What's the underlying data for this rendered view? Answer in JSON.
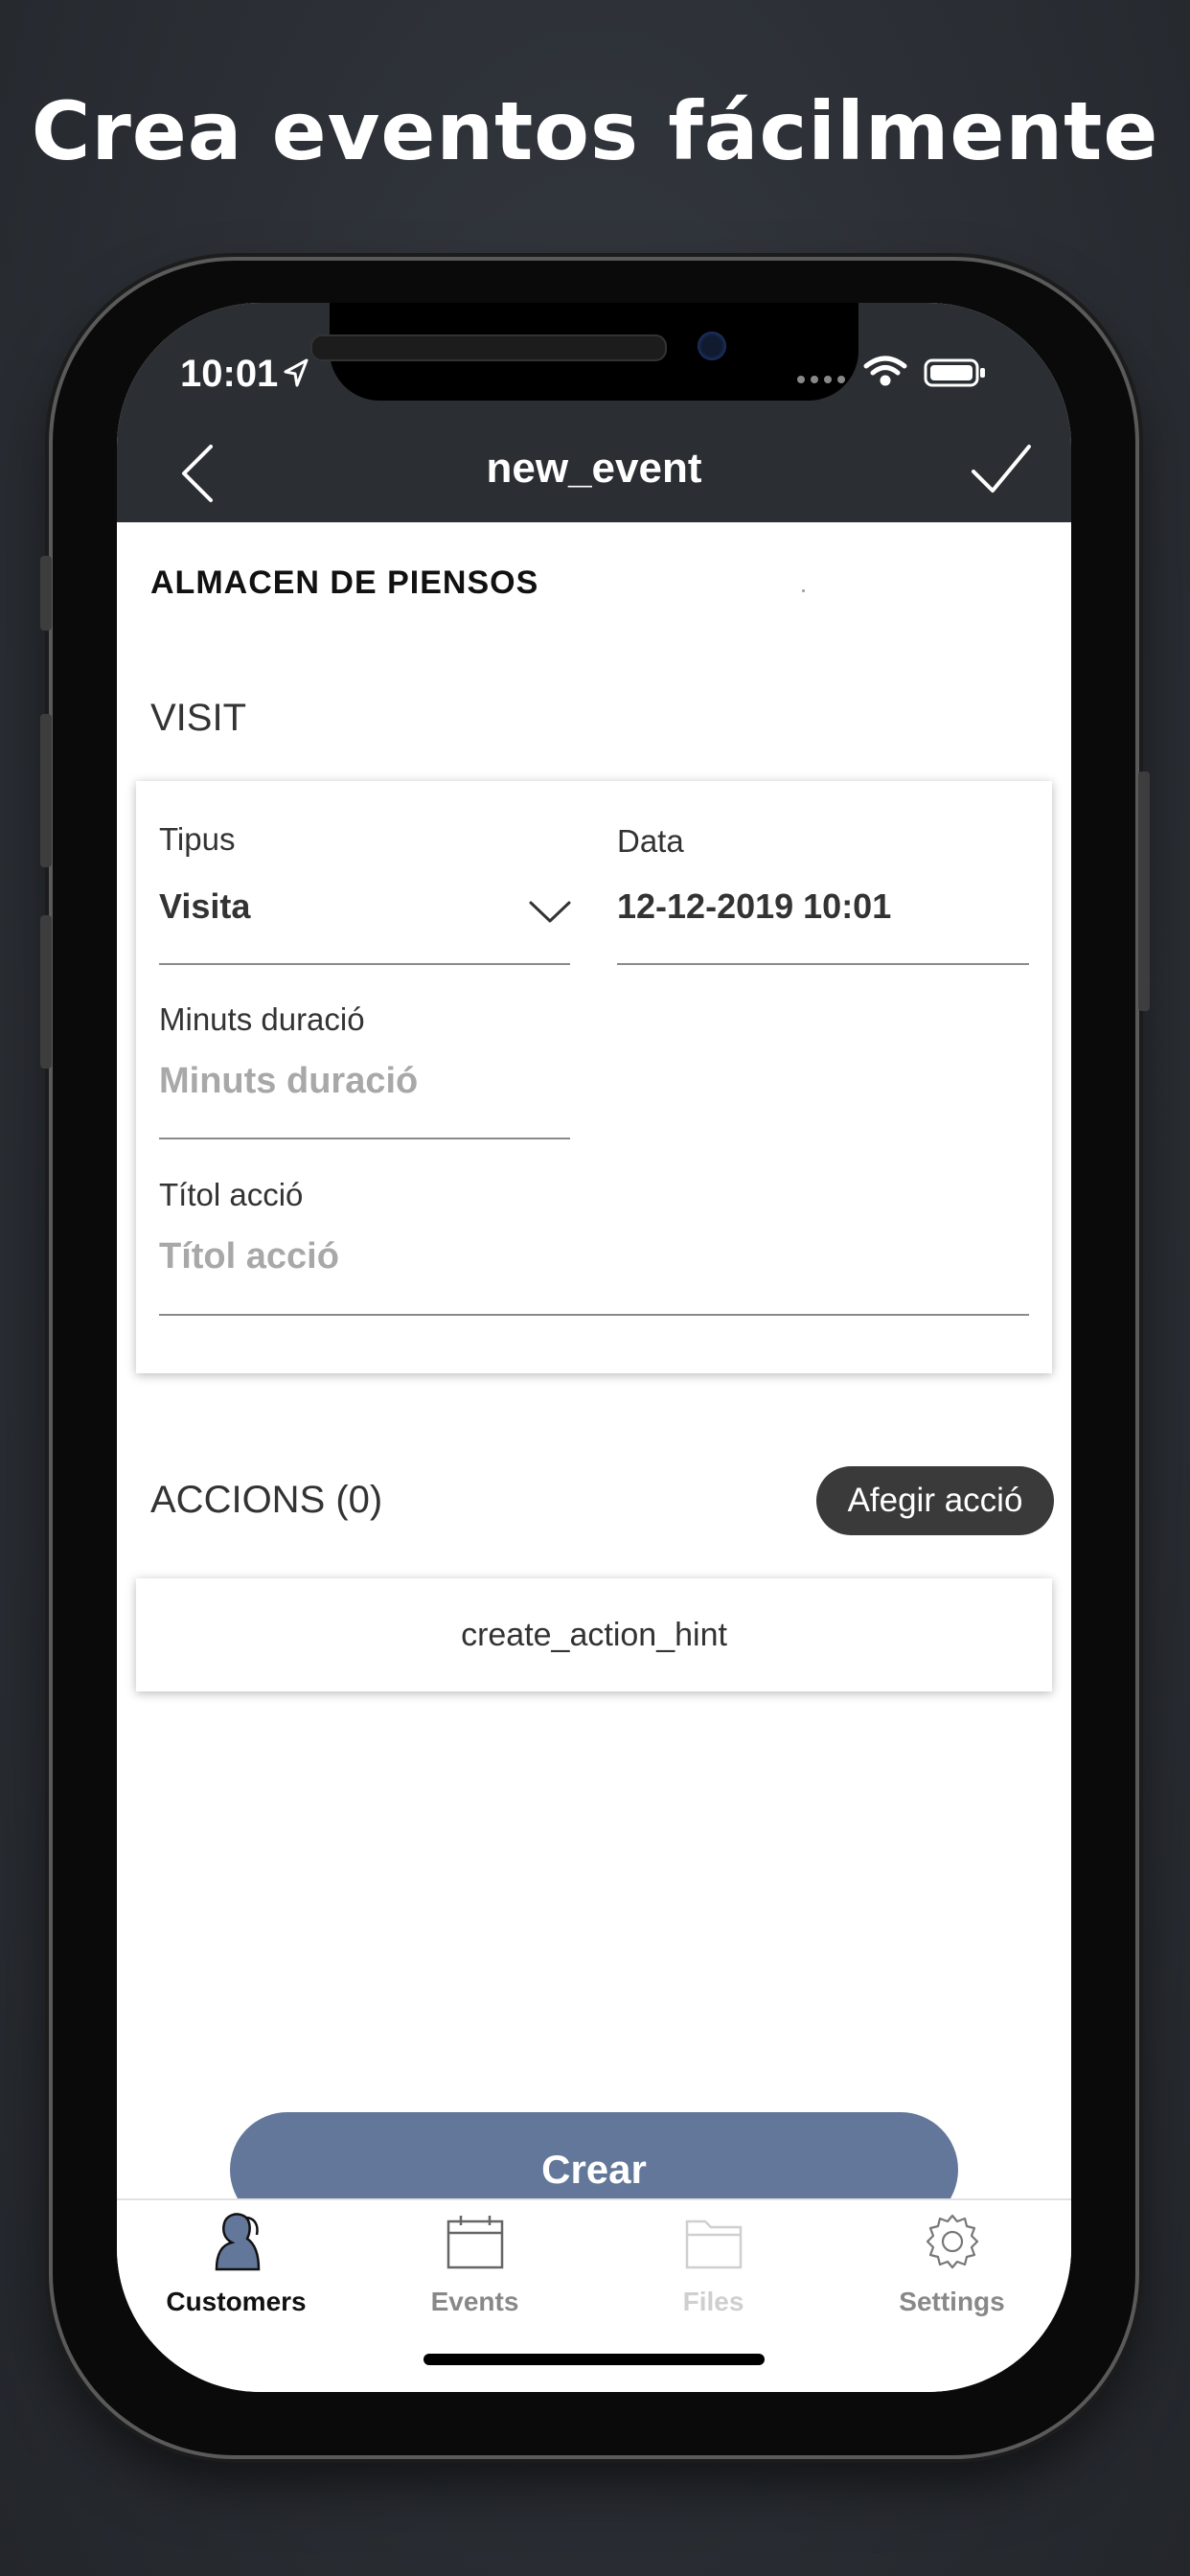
{
  "headline": "Crea eventos fácilmente",
  "status_bar": {
    "time": "10:01"
  },
  "navbar": {
    "title": "new_event"
  },
  "customer_name": "ALMACEN DE PIENSOS",
  "visit_section": "VISIT",
  "form": {
    "type_label": "Tipus",
    "type_value": "Visita",
    "date_label": "Data",
    "date_value": "12-12-2019 10:01",
    "duration_label": "Minuts duració",
    "duration_placeholder": "Minuts duració",
    "title_label": "Títol acció",
    "title_placeholder": "Títol acció"
  },
  "actions": {
    "title": "ACCIONS (0)",
    "add_label": "Afegir acció",
    "hint": "create_action_hint"
  },
  "create_button": "Crear",
  "tabs": [
    {
      "label": "Customers",
      "icon": "customers-icon",
      "state": "active"
    },
    {
      "label": "Events",
      "icon": "calendar-icon",
      "state": "normal"
    },
    {
      "label": "Files",
      "icon": "folder-icon",
      "state": "disabled"
    },
    {
      "label": "Settings",
      "icon": "gear-icon",
      "state": "normal"
    }
  ],
  "colors": {
    "navbar": "#2b2e32",
    "create_button": "#63779a",
    "add_action_button": "#3a3a3a",
    "tab_active": "#111111",
    "tab_normal": "#888888",
    "tab_disabled": "#cfcfcf"
  }
}
